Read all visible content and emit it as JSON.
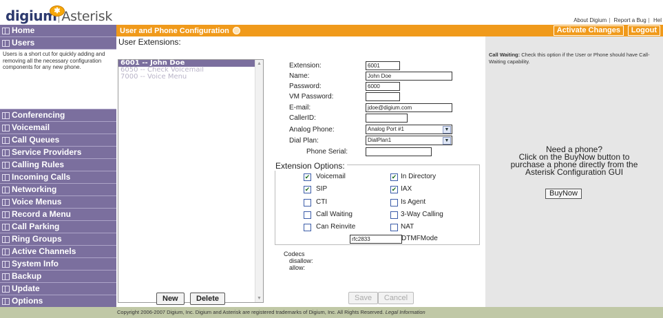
{
  "brand": {
    "name_left": "digium",
    "name_right": "Asterisk",
    "logo_icon": "asterisk-star-icon"
  },
  "top_links": [
    "About Digium",
    "Report a Bug",
    "Hel"
  ],
  "sidebar": {
    "items": [
      {
        "label": "Home"
      },
      {
        "label": "Users"
      },
      {
        "label": "Conferencing"
      },
      {
        "label": "Voicemail"
      },
      {
        "label": "Call Queues"
      },
      {
        "label": "Service Providers"
      },
      {
        "label": "Calling Rules"
      },
      {
        "label": "Incoming Calls"
      },
      {
        "label": "Networking"
      },
      {
        "label": "Voice Menus"
      },
      {
        "label": "Record a Menu"
      },
      {
        "label": "Call Parking"
      },
      {
        "label": "Ring Groups"
      },
      {
        "label": "Active Channels"
      },
      {
        "label": "System Info"
      },
      {
        "label": "Backup"
      },
      {
        "label": "Update"
      },
      {
        "label": "Options"
      }
    ],
    "users_description": "Users is a short cut for quickly adding and removing all the necessary configuration components for any new phone."
  },
  "titlebar": {
    "title": "User and Phone Configuration",
    "activate_label": "Activate Changes",
    "logout_label": "Logout"
  },
  "user_extensions": {
    "label": "User Extensions:",
    "items": [
      {
        "label": "6001 -- John Doe",
        "selected": true
      },
      {
        "label": "6050 -- Check Voicemail",
        "selected": false
      },
      {
        "label": "7000 -- Voice Menu",
        "selected": false
      }
    ],
    "new_label": "New",
    "delete_label": "Delete"
  },
  "form": {
    "extension_label": "Extension:",
    "extension_value": "6001",
    "name_label": "Name:",
    "name_value": "John Doe",
    "password_label": "Password:",
    "password_value": "6000",
    "vm_password_label": "VM Password:",
    "vm_password_value": "",
    "email_label": "E-mail:",
    "email_value": "jdoe@digium.com",
    "callerid_label": "CallerID:",
    "callerid_value": "",
    "analog_phone_label": "Analog Phone:",
    "analog_phone_value": "Analog Port #1",
    "dial_plan_label": "Dial Plan:",
    "dial_plan_value": "DialPlan1",
    "phone_serial_label": "Phone Serial:",
    "phone_serial_value": ""
  },
  "extension_options": {
    "title": "Extension Options:",
    "voicemail": {
      "label": "Voicemail",
      "checked": true
    },
    "in_directory": {
      "label": "In Directory",
      "checked": true
    },
    "sip": {
      "label": "SIP",
      "checked": true
    },
    "iax": {
      "label": "IAX",
      "checked": true
    },
    "cti": {
      "label": "CTI",
      "checked": false
    },
    "is_agent": {
      "label": "Is Agent",
      "checked": false
    },
    "call_waiting": {
      "label": "Call Waiting",
      "checked": false
    },
    "three_way": {
      "label": "3-Way Calling",
      "checked": false
    },
    "can_reinvite": {
      "label": "Can Reinvite",
      "checked": false
    },
    "nat": {
      "label": "NAT",
      "checked": false
    },
    "dtmf_value": "rfc2833",
    "dtmf_label": "DTMFMode"
  },
  "codecs": {
    "title": "Codecs",
    "disallow_label": "disallow:",
    "allow_label": "allow:"
  },
  "actions": {
    "save_label": "Save",
    "cancel_label": "Cancel"
  },
  "help": {
    "title": "Call Waiting:",
    "text": "Check this option if the User or Phone should have Call-Waiting capability."
  },
  "promo": {
    "line1": "Need a phone?",
    "line2": "Click on the BuyNow button to",
    "line3": "purchase a phone directly from the",
    "line4": "Asterisk Configuration GUI",
    "buy_label": "BuyNow"
  },
  "footer": {
    "text": "Copyright 2006-2007 Digium, Inc. Digium and Asterisk are registered trademarks of Digium, Inc. All Rights Reserved.",
    "legal": "Legal Information"
  },
  "colors": {
    "sidebar_bg": "#7b6f9e",
    "titlebar_bg": "#f09a1b",
    "footer_bg": "#c0c8a6",
    "right_panel_bg": "#e6e6e6"
  }
}
